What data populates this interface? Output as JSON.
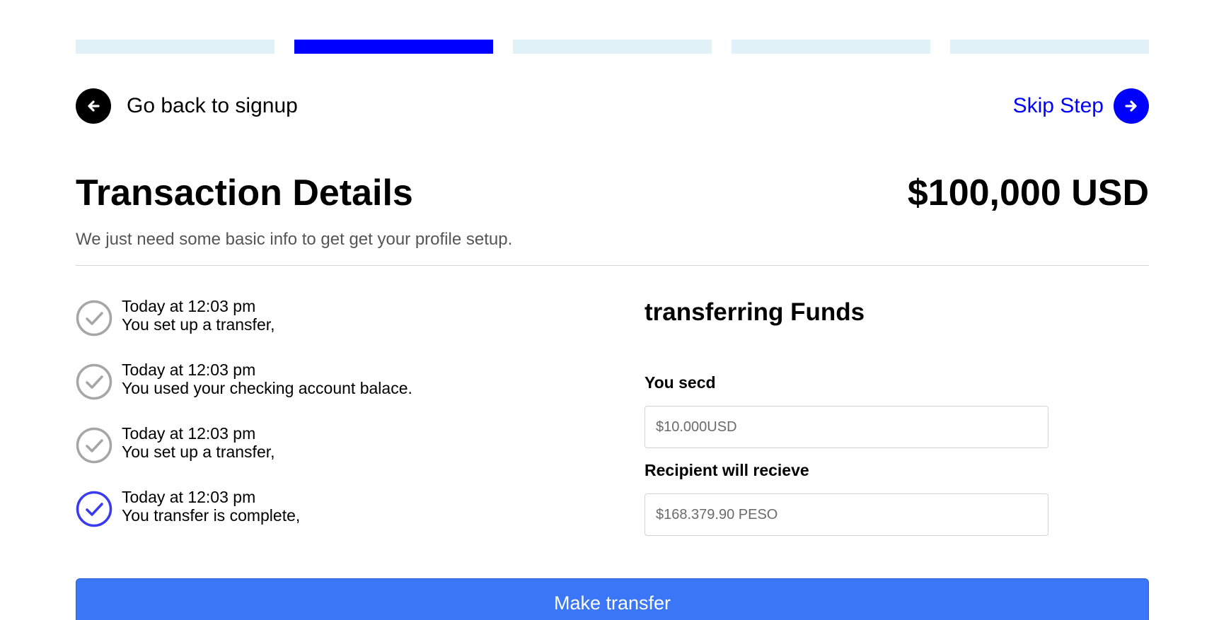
{
  "progress": {
    "total_steps": 5,
    "active_step": 2
  },
  "nav": {
    "back_label": "Go back to signup",
    "skip_label": "Skip Step"
  },
  "header": {
    "title": "Transaction Details",
    "amount": "$100,000 USD",
    "subtitle": "We just need some basic info to get get your profile setup."
  },
  "timeline": [
    {
      "time": "Today at 12:03 pm",
      "text": "You set up a transfer,",
      "state": "done",
      "icon": "check-circle-icon"
    },
    {
      "time": "Today at 12:03 pm",
      "text": "You used your checking account balace.",
      "state": "done",
      "icon": "check-circle-icon"
    },
    {
      "time": "Today at 12:03 pm",
      "text": "You set up a transfer,",
      "state": "done",
      "icon": "check-circle-icon"
    },
    {
      "time": "Today at 12:03 pm",
      "text": "You transfer is complete,",
      "state": "complete",
      "icon": "check-circle-icon"
    }
  ],
  "form": {
    "title": "transferring Funds",
    "send_label": "You secd",
    "send_placeholder": "$10.000USD",
    "receive_label": "Recipient will recieve",
    "receive_placeholder": "$168.379.90 PESO"
  },
  "button": {
    "label": "Make transfer"
  },
  "colors": {
    "accent": "#0000ff",
    "progress_inactive": "#e1f1f8",
    "button": "#3b76f6",
    "check_done": "#a6a6a6",
    "check_complete": "#3a3af0"
  }
}
